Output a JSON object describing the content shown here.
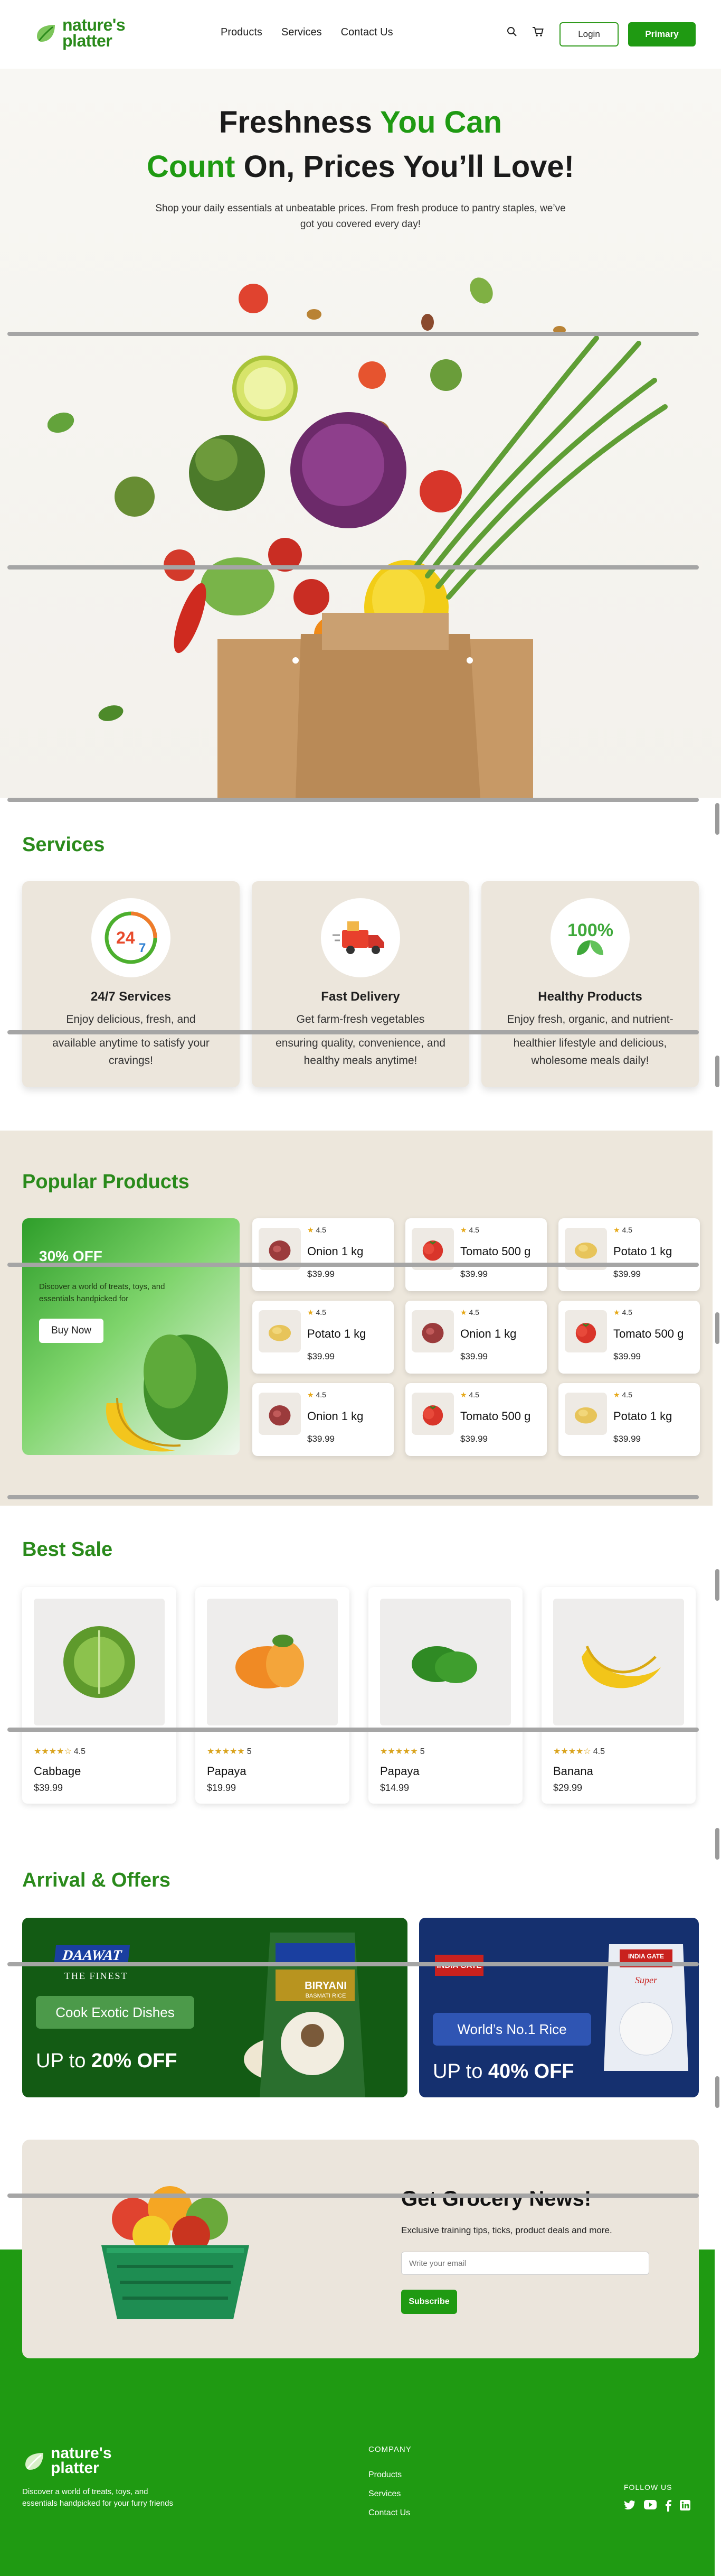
{
  "brand": {
    "name_line1": "nature's",
    "name_line2": "platter"
  },
  "nav": {
    "links": [
      "Products",
      "Services",
      "Contact Us"
    ],
    "login": "Login",
    "primary": "Primary"
  },
  "hero": {
    "line1_a": "Freshness ",
    "line1_b": "You Can",
    "line2_a": "Count",
    "line2_b": " On, Prices You’ll Love!",
    "subtitle": "Shop your daily essentials at unbeatable prices. From fresh produce to pantry staples, we’ve got you covered every day!"
  },
  "services": {
    "title": "Services",
    "cards": [
      {
        "icon": "clock-24-7-icon",
        "title": "24/7 Services",
        "desc_top": "Enjoy delicious, fresh, and",
        "desc_bottom": "available anytime to satisfy your cravings!"
      },
      {
        "icon": "delivery-truck-icon",
        "title": "Fast Delivery",
        "desc_top": "Get farm-fresh vegetables",
        "desc_bottom": "ensuring quality, convenience, and healthy meals anytime!"
      },
      {
        "icon": "100-percent-leaf-icon",
        "title": "Healthy Products",
        "desc_top": "Enjoy fresh, organic, and nutrient-",
        "desc_bottom": "healthier lifestyle and delicious, wholesome meals daily!"
      }
    ]
  },
  "popular": {
    "title": "Popular Products",
    "promo": {
      "headline": "30% OFF",
      "text": "Discover a world of treats, toys, and essentials handpicked for",
      "button": "Buy Now"
    },
    "products": [
      {
        "rating": "4.5",
        "name": "Onion 1 kg",
        "price": "$39.99",
        "kind": "onion"
      },
      {
        "rating": "4.5",
        "name": "Tomato 500 g",
        "price": "$39.99",
        "kind": "tomato"
      },
      {
        "rating": "4.5",
        "name": "Potato 1 kg",
        "price": "$39.99",
        "kind": "potato"
      },
      {
        "rating": "4.5",
        "name": "Potato 1 kg",
        "price": "$39.99",
        "kind": "potato"
      },
      {
        "rating": "4.5",
        "name": "Onion 1 kg",
        "price": "$39.99",
        "kind": "onion"
      },
      {
        "rating": "4.5",
        "name": "Tomato 500 g",
        "price": "$39.99",
        "kind": "tomato"
      },
      {
        "rating": "4.5",
        "name": "Onion 1 kg",
        "price": "$39.99",
        "kind": "onion"
      },
      {
        "rating": "4.5",
        "name": "Tomato 500 g",
        "price": "$39.99",
        "kind": "tomato"
      },
      {
        "rating": "4.5",
        "name": "Potato 1 kg",
        "price": "$39.99",
        "kind": "potato"
      }
    ]
  },
  "best_sale": {
    "title": "Best Sale",
    "items": [
      {
        "name": "Cabbage",
        "price": "$39.99",
        "rating": "4.5",
        "stars": "★★★★☆",
        "kind": "cabbage"
      },
      {
        "name": "Papaya",
        "price": "$19.99",
        "rating": "5",
        "stars": "★★★★★",
        "kind": "papaya"
      },
      {
        "name": "Papaya",
        "price": "$14.99",
        "rating": "5",
        "stars": "★★★★★",
        "kind": "pepper"
      },
      {
        "name": "Banana",
        "price": "$29.99",
        "rating": "4.5",
        "stars": "★★★★☆",
        "kind": "banana"
      }
    ]
  },
  "offers": {
    "title": "Arrival & Offers",
    "left": {
      "brand": "DAAWAT",
      "brand_sub": "THE FINEST",
      "pack_label": "BIRYANI",
      "pack_sub": "BASMATI RICE",
      "tag": "Cook Exotic Dishes",
      "deal_prefix": "UP to ",
      "deal_value": "20% OFF"
    },
    "right": {
      "brand": "INDIA GATE",
      "pack_label": "INDIA GATE",
      "pack_sub": "Super",
      "tag": "World’s No.1 Rice",
      "deal_prefix": "UP to ",
      "deal_value": "40% OFF"
    }
  },
  "newsletter": {
    "title": "Get Grocery News!",
    "text": "Exclusive training tips, ticks, product deals and more.",
    "placeholder": "Write your email",
    "button": "Subscribe"
  },
  "footer": {
    "tagline": "Discover a world of treats, toys, and essentials handpicked for your furry friends",
    "company_heading": "COMPANY",
    "company_links": [
      "Products",
      "Services",
      "Contact Us"
    ],
    "follow_heading": "FOLLOW US"
  },
  "colors": {
    "brand_green": "#1f9a12",
    "dark_green_offer": "#135b14",
    "navy_offer": "#15306f",
    "cream": "#ede7dc"
  }
}
